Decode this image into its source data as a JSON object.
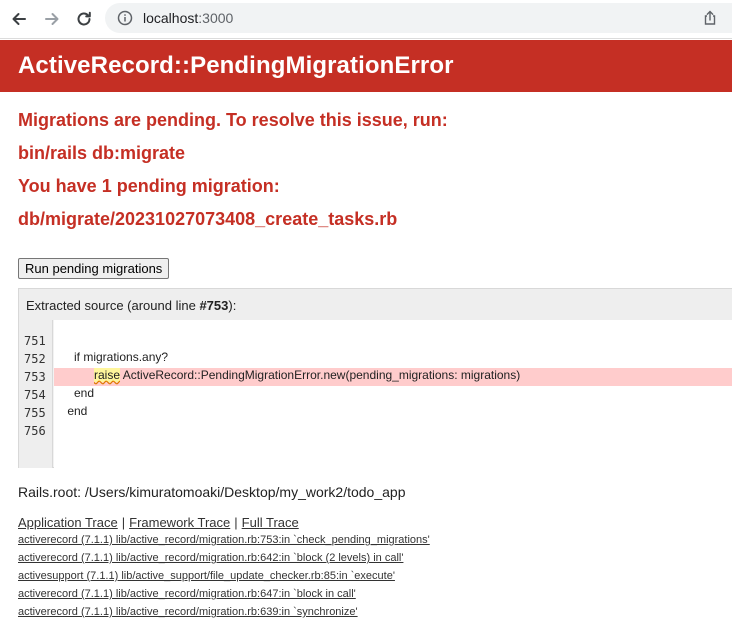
{
  "browser": {
    "url_host": "localhost",
    "url_port": ":3000"
  },
  "error": {
    "title": "ActiveRecord::PendingMigrationError",
    "messages": [
      "Migrations are pending. To resolve this issue, run:",
      "bin/rails db:migrate",
      "You have 1 pending migration:",
      "db/migrate/20231027073408_create_tasks.rb"
    ]
  },
  "run_button_label": "Run pending migrations",
  "source": {
    "header_prefix": "Extracted source (around line ",
    "header_line": "#753",
    "header_suffix": "):",
    "line_numbers": [
      "751",
      "752",
      "753",
      "754",
      "755",
      "756"
    ],
    "lines": [
      "",
      "      if migrations.any?",
      "",
      "      end",
      "    end",
      ""
    ],
    "highlight_keyword": "raise",
    "highlight_rest": " ActiveRecord::PendingMigrationError.new(pending_migrations: migrations)"
  },
  "rails_root": "Rails.root: /Users/kimuratomoaki/Desktop/my_work2/todo_app",
  "trace_tabs": [
    "Application Trace",
    "Framework Trace",
    "Full Trace"
  ],
  "trace_separator": "|",
  "trace_lines": [
    "activerecord (7.1.1) lib/active_record/migration.rb:753:in `check_pending_migrations'",
    "activerecord (7.1.1) lib/active_record/migration.rb:642:in `block (2 levels) in call'",
    "activesupport (7.1.1) lib/active_support/file_update_checker.rb:85:in `execute'",
    "activerecord (7.1.1) lib/active_record/migration.rb:647:in `block in call'",
    "activerecord (7.1.1) lib/active_record/migration.rb:639:in `synchronize'"
  ],
  "colors": {
    "error_red": "#c52f24",
    "highlight_line": "#ffcccc"
  },
  "icons": [
    "back-arrow-icon",
    "forward-arrow-icon",
    "reload-icon",
    "info-icon",
    "share-icon"
  ]
}
